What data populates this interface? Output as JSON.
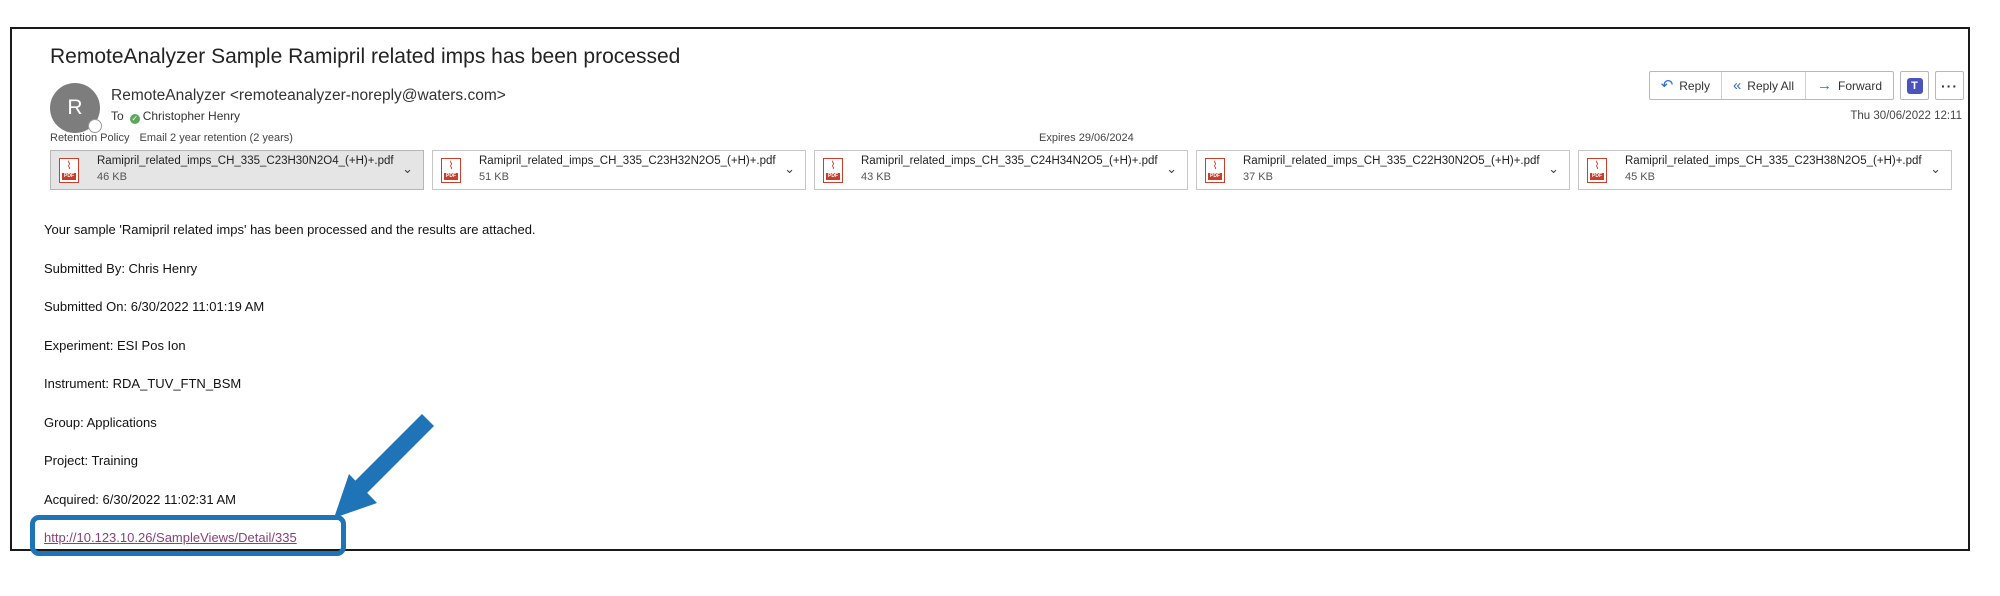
{
  "email": {
    "subject": "RemoteAnalyzer Sample Ramipril related imps has been processed",
    "avatar_initial": "R",
    "sender": "RemoteAnalyzer <remoteanalyzer-noreply@waters.com>",
    "to_label": "To",
    "recipient": "Christopher Henry",
    "retention_label": "Retention Policy",
    "retention_value": "Email 2 year retention (2 years)",
    "expires": "Expires  29/06/2024",
    "date": "Thu 30/06/2022 12:11"
  },
  "actions": {
    "reply": "Reply",
    "reply_all": "Reply All",
    "forward": "Forward",
    "teams_icon": "teams-icon",
    "more_icon": "more-icon"
  },
  "attachments": [
    {
      "name": "Ramipril_related_imps_CH_335_C23H30N2O4_(+H)+.pdf",
      "size": "46 KB",
      "selected": true
    },
    {
      "name": "Ramipril_related_imps_CH_335_C23H32N2O5_(+H)+.pdf",
      "size": "51 KB",
      "selected": false
    },
    {
      "name": "Ramipril_related_imps_CH_335_C24H34N2O5_(+H)+.pdf",
      "size": "43 KB",
      "selected": false
    },
    {
      "name": "Ramipril_related_imps_CH_335_C22H30N2O5_(+H)+.pdf",
      "size": "37 KB",
      "selected": false
    },
    {
      "name": "Ramipril_related_imps_CH_335_C23H38N2O5_(+H)+.pdf",
      "size": "45 KB",
      "selected": false
    }
  ],
  "body": {
    "lines": [
      "Your sample 'Ramipril related imps' has been processed and the results are attached.",
      "Submitted By: Chris Henry",
      "Submitted On: 6/30/2022 11:01:19 AM",
      "Experiment: ESI Pos Ion",
      "Instrument: RDA_TUV_FTN_BSM",
      "Group: Applications",
      "Project: Training",
      "Acquired: 6/30/2022 11:02:31 AM"
    ],
    "link": "http://10.123.10.26/SampleViews/Detail/335"
  },
  "colors": {
    "callout": "#1f74b7",
    "link": "#8a3f7a",
    "accent": "#2e6bd1"
  }
}
